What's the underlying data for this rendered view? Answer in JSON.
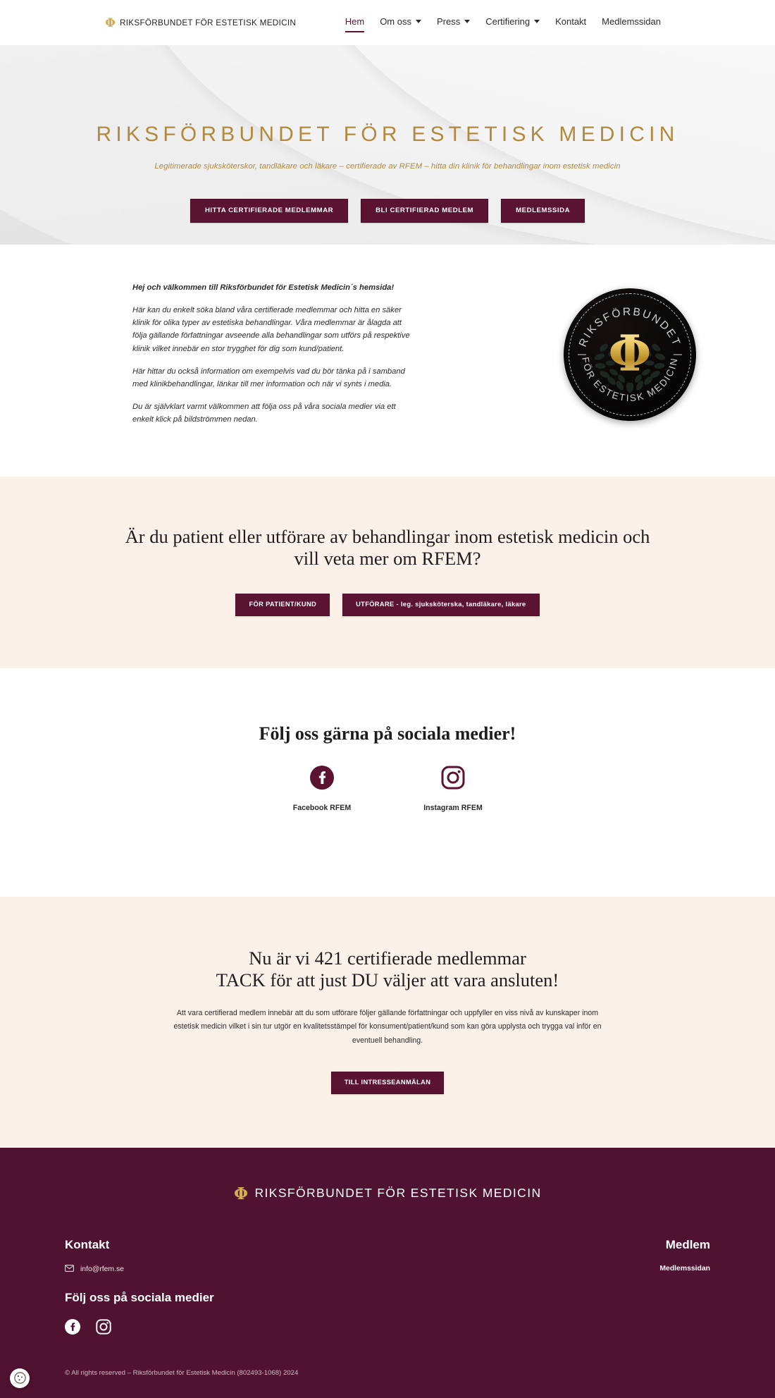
{
  "colors": {
    "brand_plum": "#5a1330",
    "footer_plum": "#4f1230",
    "gold": "#b08a3e",
    "cream": "#fbf1e8"
  },
  "header": {
    "logo_icon": "phi-medal-icon",
    "brand_text": "RIKSFÖRBUNDET FÖR ESTETISK MEDICIN",
    "nav": [
      {
        "label": "Hem",
        "has_dropdown": false,
        "active": true
      },
      {
        "label": "Om oss",
        "has_dropdown": true,
        "active": false
      },
      {
        "label": "Press",
        "has_dropdown": true,
        "active": false
      },
      {
        "label": "Certifiering",
        "has_dropdown": true,
        "active": false
      },
      {
        "label": "Kontakt",
        "has_dropdown": false,
        "active": false
      },
      {
        "label": "Medlemssidan",
        "has_dropdown": false,
        "active": false
      }
    ]
  },
  "hero": {
    "title": "RIKSFÖRBUNDET FÖR ESTETISK MEDICIN",
    "subtitle": "Legitimerade sjuksköterskor, tandläkare och läkare – certifierade av RFEM – hitta din klinik för behandlingar inom estetisk medicin",
    "buttons": [
      {
        "label": "HITTA CERTIFIERADE MEDLEMMAR"
      },
      {
        "label": "BLI CERTIFIERAD MEDLEM"
      },
      {
        "label": "MEDLEMSSIDA"
      }
    ]
  },
  "intro": {
    "lead": "Hej och välkommen till Riksförbundet för Estetisk Medicin´s hemsida!",
    "paragraphs": [
      "Här kan du enkelt söka bland våra certifierade medlemmar och hitta en säker klinik för olika typer av estetiska behandlingar. Våra medlemmar är ålagda att följa gällande författningar avseende alla behandlingar som utförs på respektive klinik vilket innebär en stor trygghet för dig som kund/patient.",
      "Här hittar du också information om exempelvis vad du bör tänka på i samband med klinikbehandlingar, länkar till mer information och när vi synts i media.",
      "Du är självklart varmt välkommen att följa oss på våra sociala medier via ett enkelt klick på bildströmmen nedan."
    ],
    "medal": {
      "top_text": "RIKSFÖRBUNDET",
      "bottom_text": "FÖR ESTETISK MEDICIN",
      "symbol": "Φ"
    }
  },
  "cta": {
    "heading_line1": "Är du patient eller utförare av behandlingar inom estetisk medicin och",
    "heading_line2": "vill veta mer om RFEM?",
    "buttons": [
      {
        "label": "FÖR PATIENT/KUND"
      },
      {
        "label": "UTFÖRARE - leg. sjuksköterska, tandläkare, läkare"
      }
    ]
  },
  "social": {
    "heading": "Följ oss gärna på sociala medier!",
    "items": [
      {
        "icon": "facebook-icon",
        "label": "Facebook RFEM"
      },
      {
        "icon": "instagram-icon",
        "label": "Instagram RFEM"
      }
    ]
  },
  "members": {
    "heading_line1": "Nu är vi 421 certifierade medlemmar",
    "heading_line2": "TACK för att just DU väljer att vara ansluten!",
    "member_count": "421",
    "body": "Att vara certifierad medlem innebär att du som utförare följer gällande författningar och uppfyller en viss nivå av kunskaper inom estetisk medicin vilket i sin tur utgör en kvalitetsstämpel för konsument/patient/kund som kan göra upplysta och trygga val inför en eventuell behandling.",
    "button_label": "TILL INTRESSEANMÄLAN"
  },
  "footer": {
    "brand_text": "RIKSFÖRBUNDET FÖR ESTETISK MEDICIN",
    "contact_heading": "Kontakt",
    "email": "info@rfem.se",
    "email_icon": "envelope-icon",
    "social_heading": "Följ oss på sociala medier",
    "social_icons": [
      {
        "icon": "facebook-icon"
      },
      {
        "icon": "instagram-icon"
      }
    ],
    "member_heading": "Medlem",
    "member_link": "Medlemssidan",
    "copyright": "© All rights reserved – Riksförbundet för Estetisk Medicin (802493-1068) 2024",
    "cookie_icon": "cookie-icon"
  }
}
